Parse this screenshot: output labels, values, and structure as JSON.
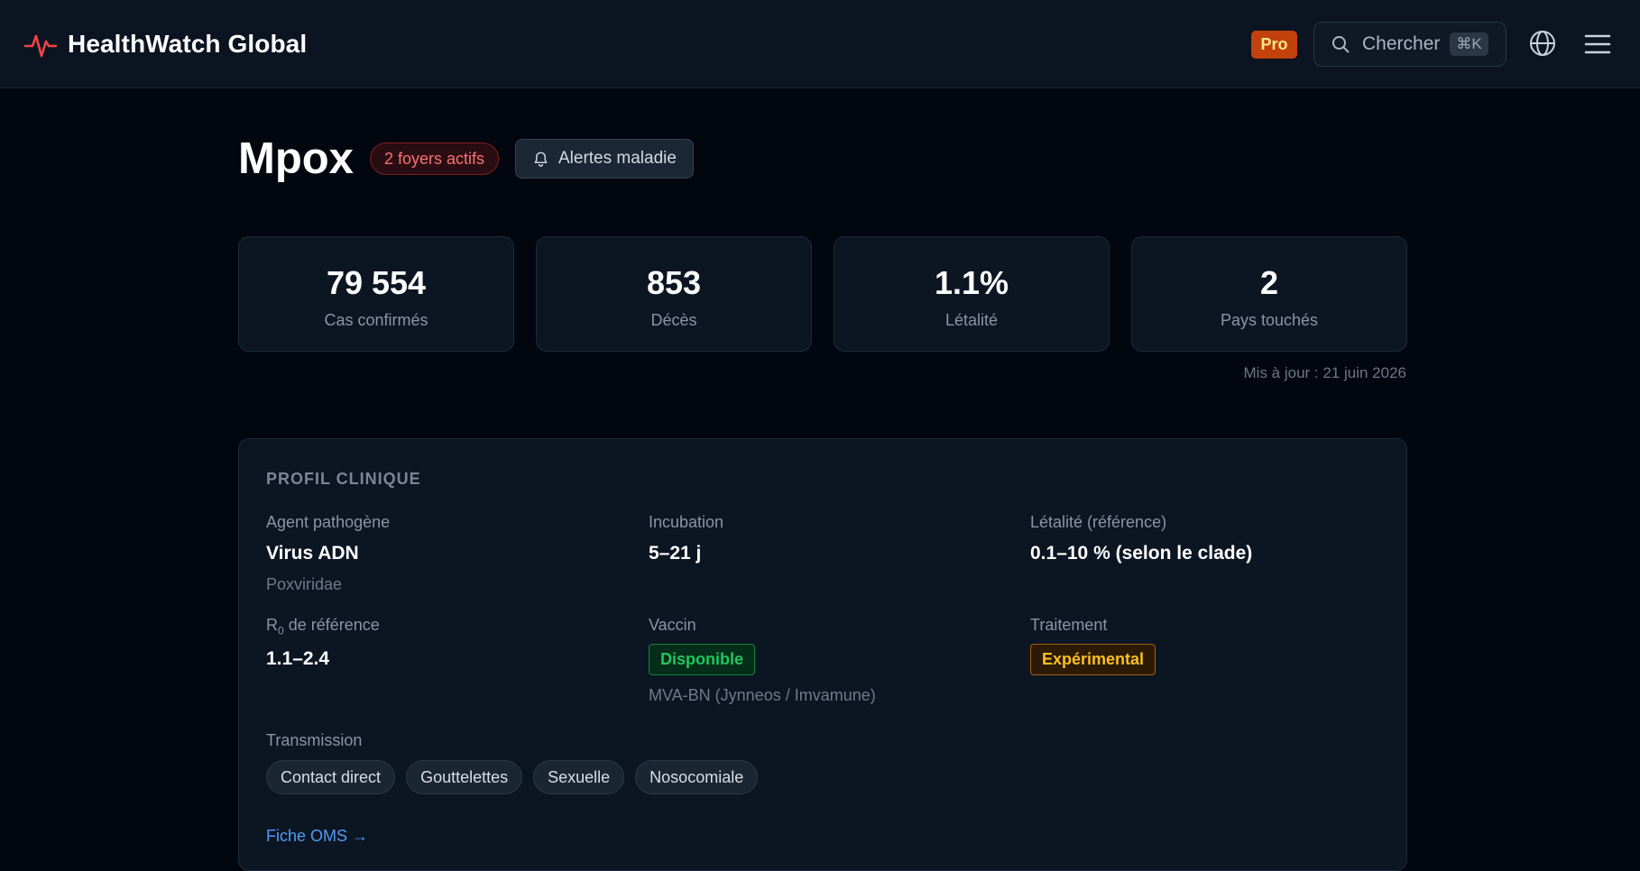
{
  "header": {
    "brand": "HealthWatch Global",
    "pro_badge": "Pro",
    "search_placeholder": "Chercher",
    "search_shortcut": "⌘K",
    "icons": {
      "logo": "heartbeat-icon",
      "search": "search-icon",
      "language": "globe-icon",
      "menu": "hamburger-menu-icon"
    },
    "accent_color": "#ef4444"
  },
  "disease": {
    "name": "Mpox",
    "outbreak_badge": "2 foyers actifs",
    "alerts_button": "Alertes maladie"
  },
  "stats": [
    {
      "value": "79 554",
      "label": "Cas confirmés"
    },
    {
      "value": "853",
      "label": "Décès"
    },
    {
      "value": "1.1%",
      "label": "Létalité"
    },
    {
      "value": "2",
      "label": "Pays touchés"
    }
  ],
  "updated": "Mis à jour : 21 juin 2026",
  "clinical_profile": {
    "title": "PROFIL CLINIQUE",
    "pathogen": {
      "label": "Agent pathogène",
      "value": "Virus ADN",
      "sub": "Poxviridae"
    },
    "incubation": {
      "label": "Incubation",
      "value": "5–21 j"
    },
    "lethality_ref": {
      "label": "Létalité (référence)",
      "value": "0.1–10 % (selon le clade)"
    },
    "r0": {
      "label_prefix": "R",
      "label_sub": "0",
      "label_suffix": " de référence",
      "value": "1.1–2.4"
    },
    "vaccine": {
      "label": "Vaccin",
      "status": "Disponible",
      "sub": "MVA-BN (Jynneos / Imvamune)"
    },
    "treatment": {
      "label": "Traitement",
      "status": "Expérimental"
    },
    "transmission": {
      "label": "Transmission",
      "modes": [
        "Contact direct",
        "Gouttelettes",
        "Sexuelle",
        "Nosocomiale"
      ]
    },
    "who_link": "Fiche OMS →"
  }
}
